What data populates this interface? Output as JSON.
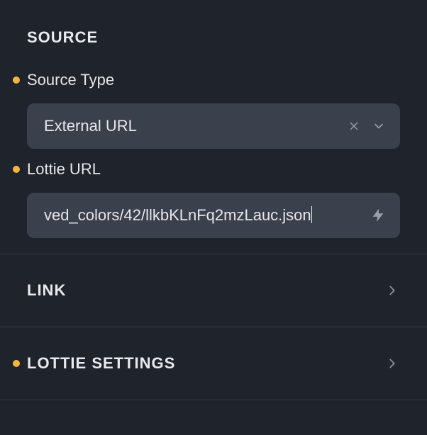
{
  "sections": {
    "source": {
      "title": "SOURCE",
      "fields": {
        "sourceType": {
          "label": "Source Type",
          "value": "External URL",
          "indicator": true
        },
        "lottieUrl": {
          "label": "Lottie URL",
          "value": "ved_colors/42/llkbKLnFq2mzLauc.json",
          "indicator": true
        }
      }
    },
    "link": {
      "title": "LINK",
      "indicator": false
    },
    "lottieSettings": {
      "title": "LOTTIE SETTINGS",
      "indicator": true
    }
  },
  "colors": {
    "indicator": "#f5b63e"
  }
}
